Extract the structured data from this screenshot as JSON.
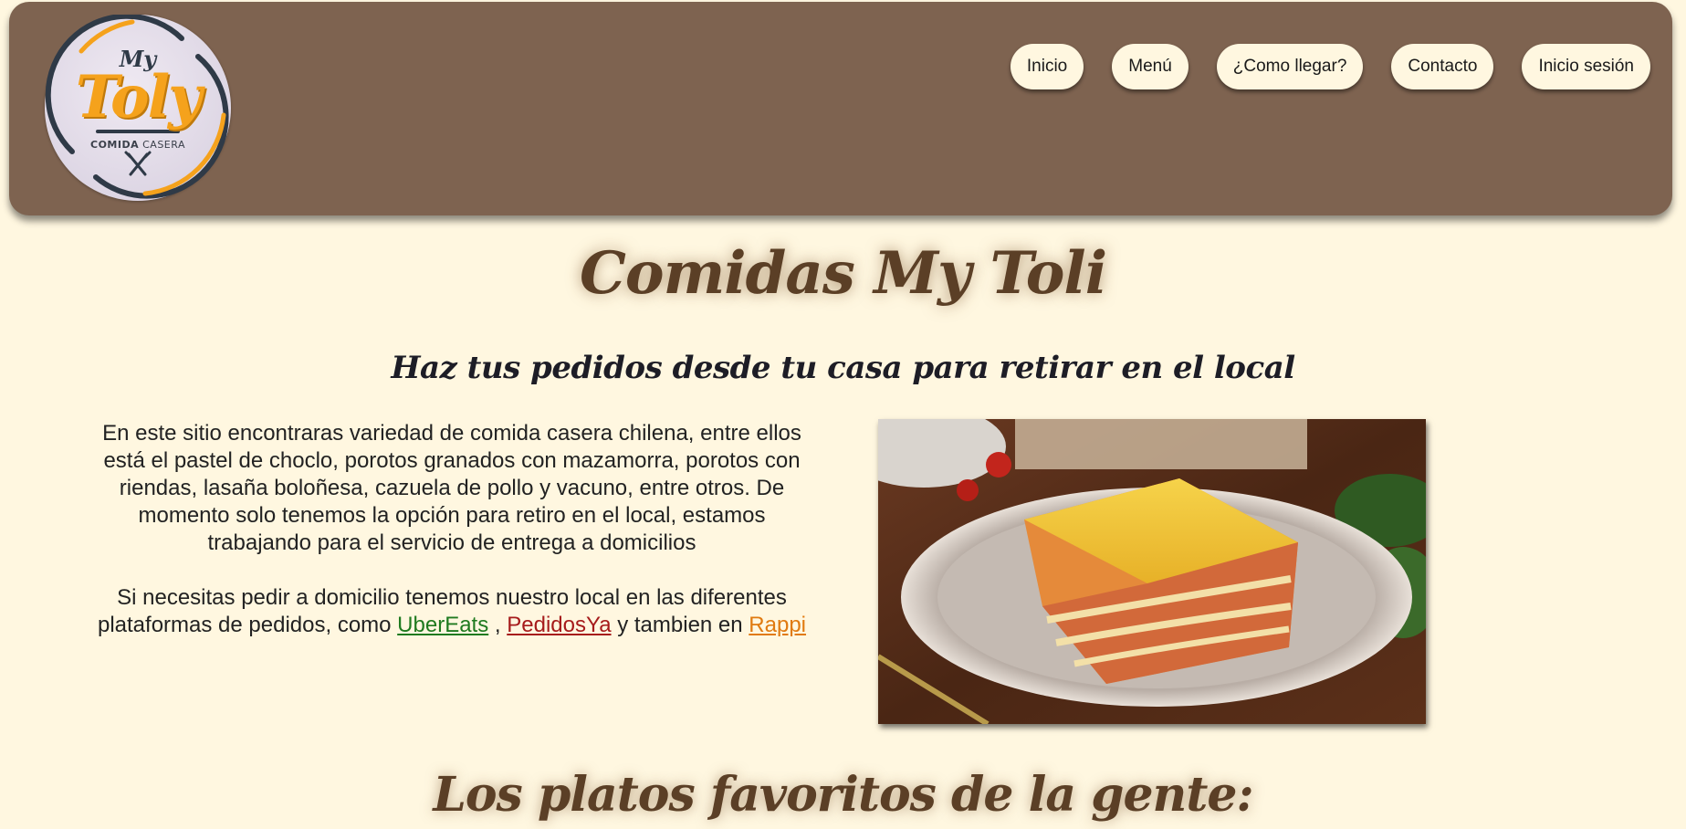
{
  "brand": {
    "my": "My",
    "name": "Toly",
    "tagline_bold": "COMIDA",
    "tagline_light": "CASERA"
  },
  "nav": {
    "items": [
      {
        "label": "Inicio"
      },
      {
        "label": "Menú"
      },
      {
        "label": "¿Como llegar?"
      },
      {
        "label": "Contacto"
      },
      {
        "label": "Inicio sesión"
      }
    ]
  },
  "hero": {
    "title": "Comidas My Toli",
    "subtitle": "Haz tus pedidos desde tu casa para retirar en el local"
  },
  "intro": {
    "paragraph1": "En este sitio encontraras variedad de comida casera chilena, entre ellos está el pastel de choclo, porotos granados con mazamorra, porotos con riendas, lasaña boloñesa, cazuela de pollo y vacuno, entre otros. De momento solo tenemos la opción para retiro en el local, estamos trabajando para el servicio de entrega a domicilios",
    "p2_before": "Si necesitas pedir a domicilio tenemos nuestro local en las diferentes plataformas de pedidos, como ",
    "link_uber": "UberEats",
    "sep": " , ",
    "link_pedidos": "PedidosYa",
    "p2_mid": " y tambien en ",
    "link_rappi": "Rappi"
  },
  "colors": {
    "header_bg": "#7e6350",
    "page_bg": "#fff7e0",
    "title_brown": "#5b3f26",
    "uber": "#1f7a1f",
    "pedidos": "#a61b1b",
    "rappi": "#e07a10"
  },
  "section": {
    "favorites_title": "Los platos favoritos de la gente:"
  }
}
